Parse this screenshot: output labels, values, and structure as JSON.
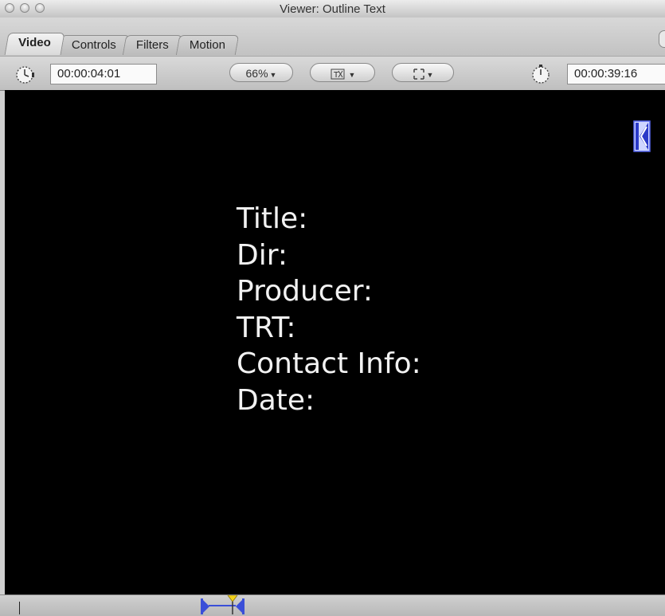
{
  "window": {
    "title": "Viewer: Outline Text"
  },
  "tabs": [
    {
      "label": "Video",
      "active": true
    },
    {
      "label": "Controls",
      "active": false
    },
    {
      "label": "Filters",
      "active": false
    },
    {
      "label": "Motion",
      "active": false
    }
  ],
  "toolbar": {
    "current_timecode": "00:00:04:01",
    "duration_timecode": "00:00:39:16",
    "zoom_label": "66%",
    "playhead_sync_icon": "clock-icon",
    "duration_icon": "stopwatch-icon"
  },
  "canvas": {
    "lines": [
      "Title:",
      "Dir:",
      "Producer:",
      "TRT:",
      "Contact Info:",
      "Date:"
    ],
    "background": "#000000",
    "text_color": "#f2f2f2"
  },
  "colors": {
    "marker_blue": "#3a4fd8",
    "playhead_yellow": "#f2d21b"
  }
}
